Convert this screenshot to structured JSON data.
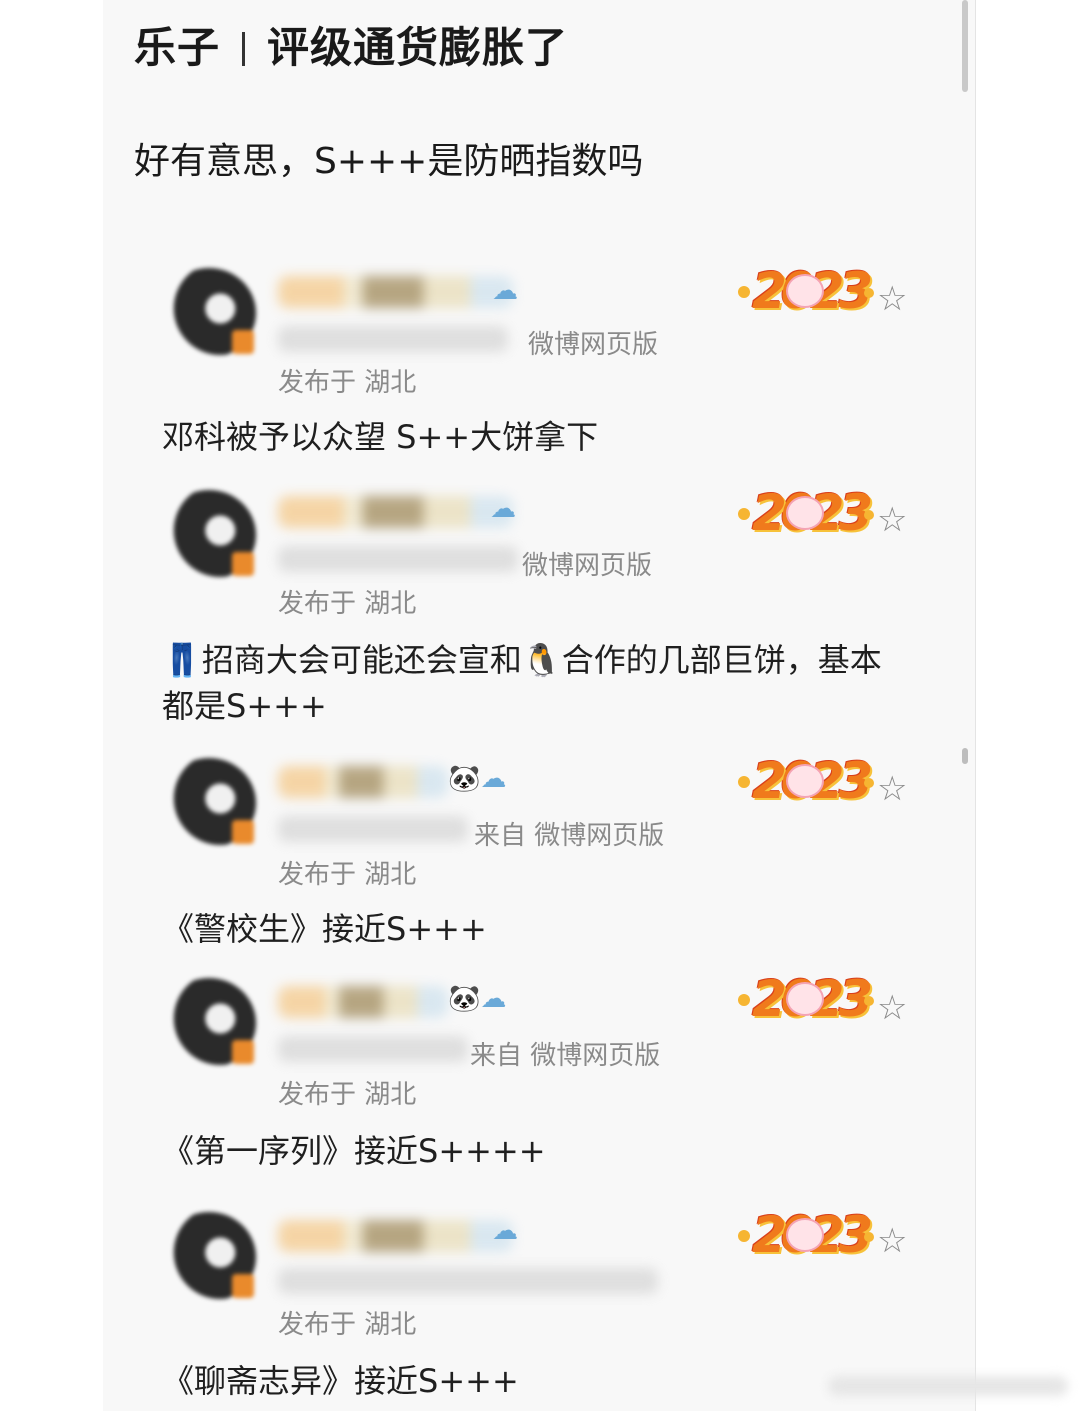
{
  "header": {
    "title_left": "乐子",
    "title_right": "评级通货膨胀了",
    "subtitle": "好有意思，S+++是防晒指数吗"
  },
  "posts": [
    {
      "badges": "☁",
      "source": "微博网页版",
      "location": "发布于 湖北",
      "content": "邓科被予以众望 S++大饼拿下",
      "year_badge": "2023"
    },
    {
      "badges": "☁",
      "source": "微博网页版",
      "location": "发布于 湖北",
      "content": "👖招商大会可能还会宣和🐧合作的几部巨饼，基本都是S+++",
      "year_badge": "2023"
    },
    {
      "badges": "🐼☁",
      "source": "来自 微博网页版",
      "location": "发布于 湖北",
      "content": "《警校生》接近S+++",
      "year_badge": "2023"
    },
    {
      "badges": "🐼☁",
      "source": "来自 微博网页版",
      "location": "发布于 湖北",
      "content": "《第一序列》接近S++++",
      "year_badge": "2023"
    },
    {
      "badges": "☁",
      "source": "",
      "location": "发布于 湖北",
      "content": "《聊斋志异》接近S+++",
      "year_badge": "2023"
    }
  ],
  "icons": {
    "favorite": "star-outline-icon"
  }
}
